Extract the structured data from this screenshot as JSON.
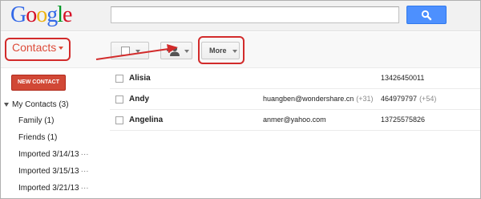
{
  "header": {
    "logo_letters": [
      {
        "char": "G",
        "color": "#3369e8"
      },
      {
        "char": "o",
        "color": "#d50f25"
      },
      {
        "char": "o",
        "color": "#eeb211"
      },
      {
        "char": "g",
        "color": "#3369e8"
      },
      {
        "char": "l",
        "color": "#009925"
      },
      {
        "char": "e",
        "color": "#d50f25"
      }
    ],
    "search_value": "",
    "search_button_icon": "search-icon"
  },
  "app": {
    "title": "Contacts",
    "accent": "#dd4b39"
  },
  "toolbar": {
    "select_icon": "checkbox-icon",
    "add_icon": "add-person-icon",
    "more_label": "More"
  },
  "sidebar": {
    "new_contact_label": "NEW CONTACT",
    "my_contacts_label": "My Contacts (3)",
    "groups": [
      {
        "label": "Family (1)",
        "dots": ""
      },
      {
        "label": "Friends (1)",
        "dots": ""
      },
      {
        "label": "Imported 3/14/13",
        "dots": "···"
      },
      {
        "label": "Imported 3/15/13",
        "dots": "···"
      },
      {
        "label": "Imported 3/21/13",
        "dots": "···"
      }
    ]
  },
  "contacts": [
    {
      "name": "Alisia",
      "email": "",
      "email_extra": "",
      "phone": "13426450011",
      "phone_extra": ""
    },
    {
      "name": "Andy",
      "email": "huangben@wondershare.cn",
      "email_extra": "(+31)",
      "phone": "464979797",
      "phone_extra": "(+54)"
    },
    {
      "name": "Angelina",
      "email": "anmer@yahoo.com",
      "email_extra": "",
      "phone": "13725575826",
      "phone_extra": ""
    }
  ],
  "annotation_color": "#d22b2b"
}
